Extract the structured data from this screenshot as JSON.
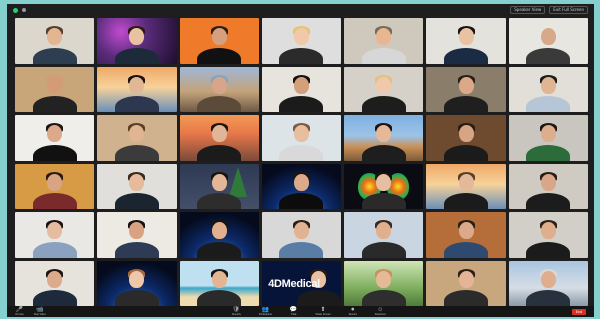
{
  "window": {
    "view_buttons": [
      "Speaker View",
      "Exit Full Screen"
    ]
  },
  "participants": [
    {
      "bg": "#dcd7cd",
      "skin": "#e2b691",
      "hair": "#5a3d2b",
      "shirt": "#2c3e50"
    },
    {
      "bg": "#5a2c7a",
      "skin": "#e9c2a2",
      "hair": "#2a1a12",
      "shirt": "#1c2a3a",
      "deco": "lights"
    },
    {
      "bg": "#ef7b2a",
      "skin": "#d6a07f",
      "hair": "#2f1d12",
      "shirt": "#111111"
    },
    {
      "bg": "#dedede",
      "skin": "#f0c9a8",
      "hair": "#e4c374",
      "shirt": "#2b2b2b"
    },
    {
      "bg": "#cfc8bc",
      "skin": "#e8b690",
      "hair": "#7c6a58",
      "shirt": "#d7d7d7"
    },
    {
      "bg": "#e4e2dd",
      "skin": "#e9c3a1",
      "hair": "#1c1410",
      "shirt": "#1b2b44"
    },
    {
      "bg": "#e8e6e1",
      "skin": "#d8a88a",
      "hair": "#e8e6e1",
      "shirt": "#3a3a3a"
    },
    {
      "bg": "#c9a57a",
      "skin": "#d39c76",
      "hair": "#d39c76",
      "shirt": "#222222"
    },
    {
      "bg": "#c7d9ee",
      "skin": "#e2b795",
      "hair": "#1a120d",
      "shirt": "#2d3850",
      "deco": "sunset"
    },
    {
      "bg": "#8aa2c2",
      "skin": "#d6a58a",
      "hair": "#8aa2c2",
      "shirt": "#5d4b3a",
      "deco": "building"
    },
    {
      "bg": "#e7e4de",
      "skin": "#d3a07a",
      "hair": "#161010",
      "shirt": "#1b1b1b"
    },
    {
      "bg": "#d5d0c8",
      "skin": "#efc9ac",
      "hair": "#e5c07e",
      "shirt": "#1d1d1d"
    },
    {
      "bg": "#8a7d6a",
      "skin": "#dca88a",
      "hair": "#2a1f16",
      "shirt": "#1f1f1f"
    },
    {
      "bg": "#e2dfd9",
      "skin": "#e0b592",
      "hair": "#1b1b1b",
      "shirt": "#b7c6d6"
    },
    {
      "bg": "#efeeea",
      "skin": "#dca98a",
      "hair": "#1e1612",
      "shirt": "#111111"
    },
    {
      "bg": "#d1b28e",
      "skin": "#e1b593",
      "hair": "#5c3d25",
      "shirt": "#3b3b3b"
    },
    {
      "bg": "#e47b3c",
      "skin": "#e0b697",
      "hair": "#1c140f",
      "shirt": "#1b1b1b",
      "deco": "bridge"
    },
    {
      "bg": "#dde4e8",
      "skin": "#e7bf9f",
      "hair": "#7b5a3f",
      "shirt": "#d9d9d9"
    },
    {
      "bg": "#7fa6cf",
      "skin": "#e4b99a",
      "hair": "#1c1410",
      "shirt": "#1e1e1e",
      "deco": "town"
    },
    {
      "bg": "#6e4a2f",
      "skin": "#d7a585",
      "hair": "#2a1c12",
      "shirt": "#1b1b1b"
    },
    {
      "bg": "#c9c6c0",
      "skin": "#dcae8d",
      "hair": "#1f1510",
      "shirt": "#2c6b3a"
    },
    {
      "bg": "#d79a45",
      "skin": "#d9a483",
      "hair": "#2a1a10",
      "shirt": "#7a2a2a"
    },
    {
      "bg": "#e0dfdc",
      "skin": "#e6ba9a",
      "hair": "#3a2a1c",
      "shirt": "#1a2530"
    },
    {
      "bg": "#2e3a52",
      "skin": "#e3b697",
      "hair": "#1a120d",
      "shirt": "#2d2d2d",
      "deco": "tree"
    },
    {
      "bg": "#0e2a6b",
      "skin": "#dca98b",
      "hair": "#1f1510",
      "shirt": "#0c0c0c",
      "deco": "earth"
    },
    {
      "bg": "#0b0b14",
      "skin": "#e6bea1",
      "hair": "#1a120d",
      "shirt": "#2a2a2a",
      "deco": "lungs"
    },
    {
      "bg": "#e9a66c",
      "skin": "#e3b99a",
      "hair": "#5b3e2a",
      "shirt": "#1b1b1b",
      "deco": "sunset"
    },
    {
      "bg": "#cfcac2",
      "skin": "#d9a788",
      "hair": "#2a1c12",
      "shirt": "#1c1c1c"
    },
    {
      "bg": "#e9e8e5",
      "skin": "#e5bca0",
      "hair": "#1b1410",
      "shirt": "#8aa2bf"
    },
    {
      "bg": "#ede9e3",
      "skin": "#d9a381",
      "hair": "#1a1210",
      "shirt": "#2d3b55"
    },
    {
      "bg": "#0d2354",
      "skin": "#e1b08f",
      "hair": "#1b1510",
      "shirt": "#1b1b1b",
      "deco": "earth"
    },
    {
      "bg": "#d8d8d8",
      "skin": "#e2b392",
      "hair": "#2b1f16",
      "shirt": "#5a7da5"
    },
    {
      "bg": "#c9d6e2",
      "skin": "#dfb08e",
      "hair": "#3a2a1e",
      "shirt": "#2a2a2a"
    },
    {
      "bg": "#b56e3a",
      "skin": "#dcaa89",
      "hair": "#2a1e15",
      "shirt": "#2e4a70"
    },
    {
      "bg": "#d2cfc9",
      "skin": "#deae8d",
      "hair": "#2e2118",
      "shirt": "#1b1b1b"
    },
    {
      "bg": "#e6e3dd",
      "skin": "#dbab8b",
      "hair": "#1e1510",
      "shirt": "#1c2a3c"
    },
    {
      "bg": "#0e2250",
      "skin": "#efc7aa",
      "hair": "#a46a3c",
      "shirt": "#2a2a2a",
      "deco": "earth"
    },
    {
      "bg": "#cbe3ef",
      "skin": "#e4b592",
      "hair": "#1a130e",
      "shirt": "#2a2a2a",
      "deco": "beach"
    },
    {
      "bg": "#07143a",
      "skin": "#e8c1a4",
      "hair": "#2a1b12",
      "shirt": "#1b1b1b",
      "deco": "4dmedical"
    },
    {
      "bg": "#bfd6a8",
      "skin": "#e6b997",
      "hair": "#c79260",
      "shirt": "#2e2e2e",
      "deco": "garden"
    },
    {
      "bg": "#c8a67e",
      "skin": "#e3b596",
      "hair": "#2c1f15",
      "shirt": "#2b2b2b"
    },
    {
      "bg": "#a7c3df",
      "skin": "#deae8f",
      "hair": "#d8d8d8",
      "shirt": "#28323f",
      "deco": "city"
    }
  ],
  "logo_text": "4DMedical",
  "toolbar": {
    "left": [
      {
        "icon": "🎤",
        "label": "Unmute"
      },
      {
        "icon": "📹",
        "label": "Stop Video"
      }
    ],
    "center": [
      {
        "icon": "🛡",
        "label": "Security"
      },
      {
        "icon": "👥",
        "label": "Participants"
      },
      {
        "icon": "💬",
        "label": "Chat"
      },
      {
        "icon": "⬆",
        "label": "Share Screen"
      },
      {
        "icon": "⏺",
        "label": "Record"
      },
      {
        "icon": "☺",
        "label": "Reactions"
      }
    ],
    "end_label": "End"
  }
}
